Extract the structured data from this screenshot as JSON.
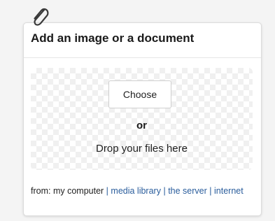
{
  "panel": {
    "title": "Add an image or a document",
    "icon": "paperclip-icon"
  },
  "dropzone": {
    "choose_label": "Choose",
    "or_label": "or",
    "drop_label": "Drop your files here"
  },
  "sources": {
    "prefix": "from: my computer",
    "separator": "|",
    "links": [
      "media library",
      "the server",
      "internet"
    ]
  },
  "colors": {
    "link": "#2a5d9c",
    "background": "#f4f4f4",
    "card": "#ffffff"
  }
}
